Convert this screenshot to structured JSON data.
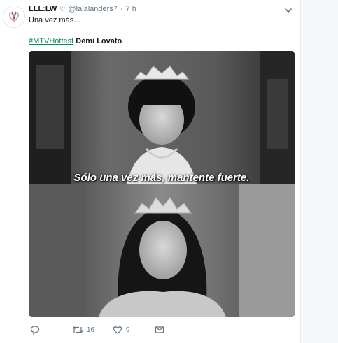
{
  "tweet": {
    "author_name": "LLL:LW",
    "author_symbol": "♡",
    "handle": "@lalalanders7",
    "separator": "·",
    "time": "7 h",
    "text_line1": "Una vez más...",
    "hashtag": "#MTVHottest",
    "mention": "Demi Lovato",
    "image_caption": "Sólo una vez más, mantente fuerte."
  },
  "actions": {
    "retweets": "16",
    "likes": "9"
  },
  "icons": {
    "avatar": "heart-logo-icon",
    "caret": "chevron-down-icon",
    "reply": "reply-icon",
    "retweet": "retweet-icon",
    "like": "heart-icon",
    "dm": "envelope-icon"
  },
  "colors": {
    "hashtag": "#0a8a5a",
    "muted": "#657786",
    "text": "#14171a"
  }
}
